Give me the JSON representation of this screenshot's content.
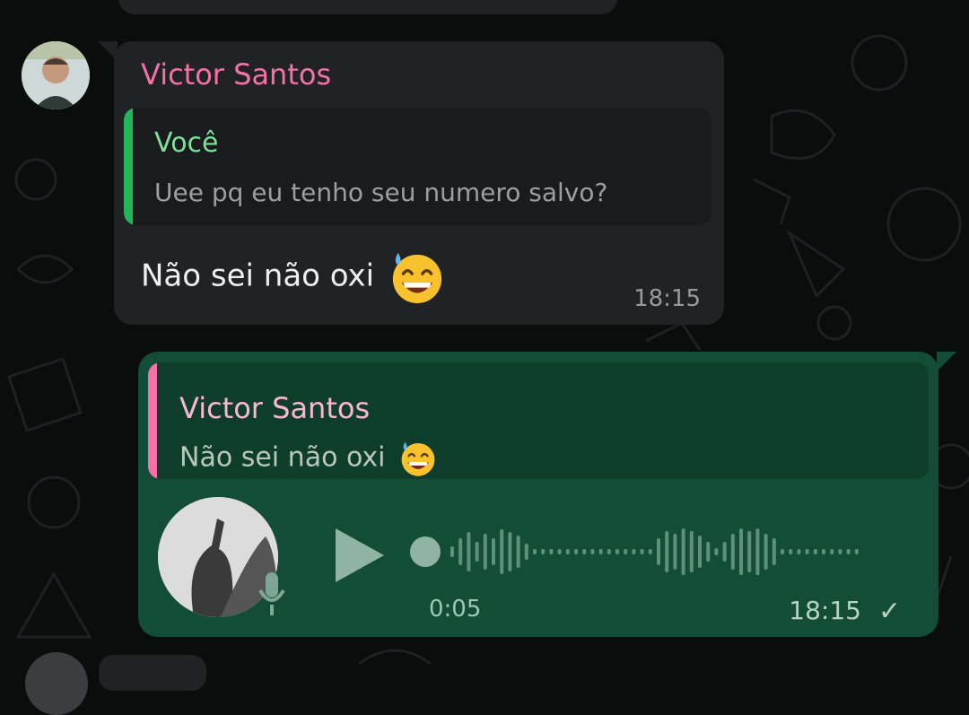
{
  "colors": {
    "background": "#0b0c0c",
    "incoming_bubble": "#202223",
    "outgoing_bubble": "#134d37",
    "sender_name": "#f571a8",
    "quote_you": "#7fe09b"
  },
  "incoming_message": {
    "sender": "Victor Santos",
    "quote": {
      "author": "Você",
      "text": "Uee pq eu tenho seu numero salvo?"
    },
    "text": "Não sei não oxi",
    "emoji": "grinning-face-with-sweat-icon",
    "time": "18:15"
  },
  "outgoing_message": {
    "quote": {
      "author": "Victor Santos",
      "text": "Não sei não oxi"
    },
    "voice_note": {
      "duration": "0:05",
      "progress": 0,
      "play_icon": "play-icon",
      "mic_icon": "mic-icon"
    },
    "time": "18:15",
    "status_icon": "check-icon"
  }
}
